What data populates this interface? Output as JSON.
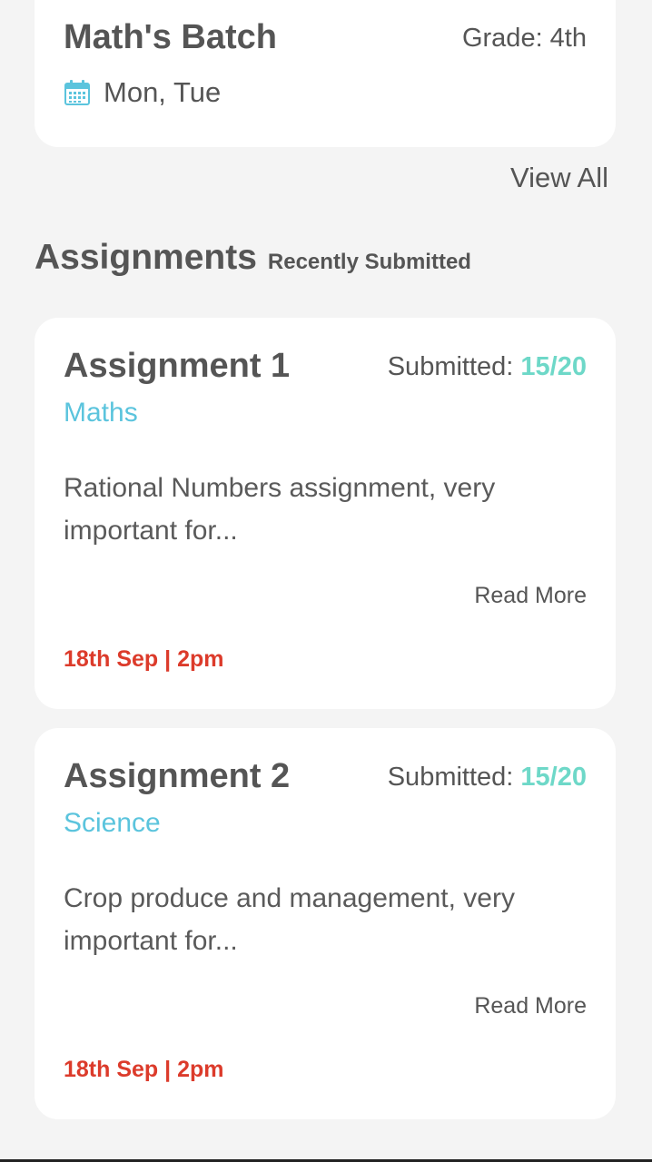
{
  "batch": {
    "title": "Math's Batch",
    "grade": "Grade: 4th",
    "days": "Mon, Tue",
    "icon": "calendar-icon"
  },
  "view_all": "View All",
  "assignments_section": {
    "title": "Assignments",
    "subtitle": "Recently Submitted"
  },
  "assignments": [
    {
      "title": "Assignment 1",
      "submitted_label": "Submitted:",
      "submitted_count": "15/20",
      "subject": "Maths",
      "description": "Rational Numbers assignment, very important for...",
      "read_more": "Read More",
      "date": "18th Sep | 2pm"
    },
    {
      "title": "Assignment 2",
      "submitted_label": "Submitted:",
      "submitted_count": "15/20",
      "subject": "Science",
      "description": "Crop produce and management, very important for...",
      "read_more": "Read More",
      "date": "18th Sep | 2pm"
    }
  ],
  "colors": {
    "background": "#f4f4f4",
    "card": "#ffffff",
    "text": "#555555",
    "accent_teal": "#6ed8c8",
    "accent_blue": "#5bc4dd",
    "date_red": "#dc3b2b"
  }
}
